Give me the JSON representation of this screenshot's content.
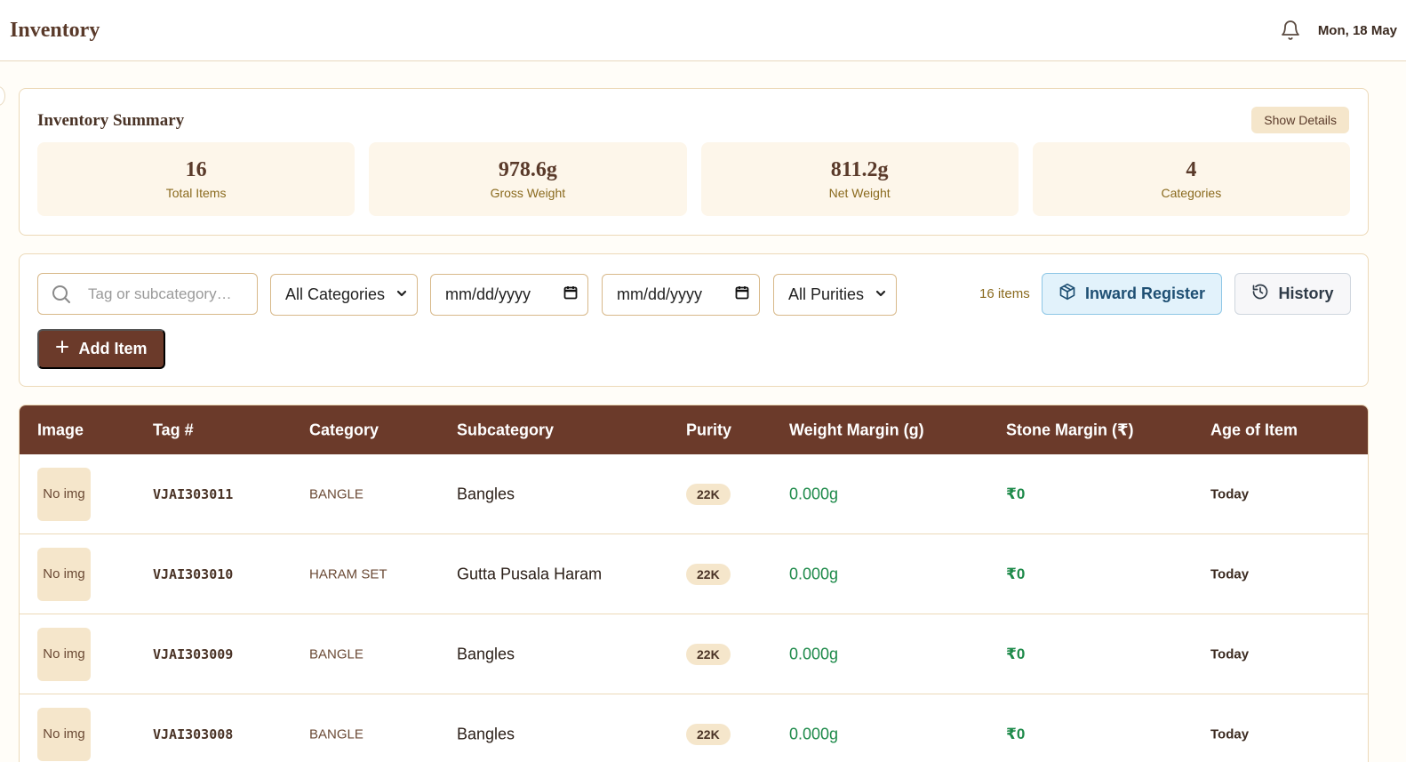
{
  "header": {
    "title": "Inventory",
    "date": "Mon, 18 May"
  },
  "summary": {
    "title": "Inventory Summary",
    "show_details_label": "Show Details",
    "stats": [
      {
        "value": "16",
        "label": "Total Items"
      },
      {
        "value": "978.6g",
        "label": "Gross Weight"
      },
      {
        "value": "811.2g",
        "label": "Net Weight"
      },
      {
        "value": "4",
        "label": "Categories"
      }
    ]
  },
  "filters": {
    "search_placeholder": "Tag or subcategory…",
    "category_selected": "All Categories",
    "date_from_placeholder": "mm/dd/yyyy",
    "date_to_placeholder": "mm/dd/yyyy",
    "purity_selected": "All Purities",
    "items_count": "16 items",
    "inward_register_label": "Inward Register",
    "history_label": "History",
    "add_item_label": "Add Item"
  },
  "table": {
    "columns": [
      "Image",
      "Tag #",
      "Category",
      "Subcategory",
      "Purity",
      "Weight Margin (g)",
      "Stone Margin (₹)",
      "Age of Item"
    ],
    "rows": [
      {
        "image": "No img",
        "tag": "VJAI303011",
        "category": "BANGLE",
        "subcategory": "Bangles",
        "purity": "22K",
        "weight_margin": "0.000g",
        "stone_margin": "₹0",
        "age": "Today"
      },
      {
        "image": "No img",
        "tag": "VJAI303010",
        "category": "HARAM SET",
        "subcategory": "Gutta Pusala Haram",
        "purity": "22K",
        "weight_margin": "0.000g",
        "stone_margin": "₹0",
        "age": "Today"
      },
      {
        "image": "No img",
        "tag": "VJAI303009",
        "category": "BANGLE",
        "subcategory": "Bangles",
        "purity": "22K",
        "weight_margin": "0.000g",
        "stone_margin": "₹0",
        "age": "Today"
      },
      {
        "image": "No img",
        "tag": "VJAI303008",
        "category": "BANGLE",
        "subcategory": "Bangles",
        "purity": "22K",
        "weight_margin": "0.000g",
        "stone_margin": "₹0",
        "age": "Today"
      }
    ]
  },
  "colors": {
    "brand": "#6b3a2a",
    "accent_bg": "#f5e6cb",
    "positive": "#1e8a4a"
  }
}
